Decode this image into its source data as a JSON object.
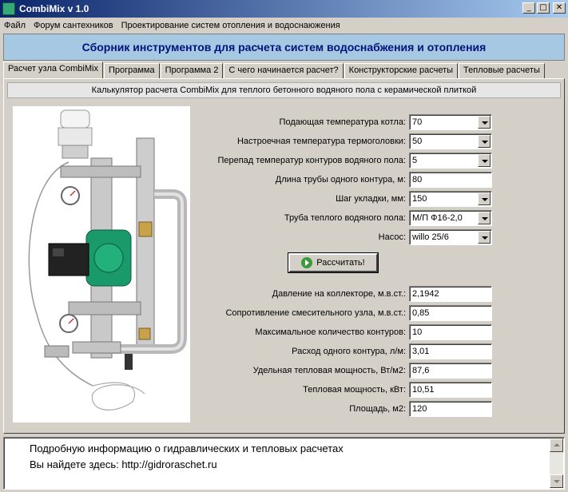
{
  "window": {
    "title": "CombiMix v 1.0",
    "btn_min": "_",
    "btn_max": "□",
    "btn_close": "✕"
  },
  "menu": [
    "Файл",
    "Форум сантехников",
    "Проектирование систем отопления и водоснаюжения"
  ],
  "banner": "Сборник инструментов для расчета систем водоснабжения и отопления",
  "tabs": [
    "Расчет узла CombiMix",
    "Программа",
    "Программа 2",
    "С чего начинается расчет?",
    "Конструкторские расчеты",
    "Тепловые расчеты"
  ],
  "calc_title": "Калькулятор расчета CombiMix для теплого бетонного водяного пола с керамической плиткой",
  "inputs": [
    {
      "label": "Подающая температура котла:",
      "value": "70",
      "combo": true
    },
    {
      "label": "Настроечная температура термоголовки:",
      "value": "50",
      "combo": true
    },
    {
      "label": "Перепад температур контуров водяного пола:",
      "value": "5",
      "combo": true
    },
    {
      "label": "Длина трубы одного контура, м:",
      "value": "80",
      "combo": false
    },
    {
      "label": "Шаг укладки, мм:",
      "value": "150",
      "combo": true
    },
    {
      "label": "Труба теплого водяного пола:",
      "value": "М/П  Ф16-2,0",
      "combo": true
    },
    {
      "label": "Насос:",
      "value": "willo 25/6",
      "combo": true
    }
  ],
  "calc_button": "Рассчитать!",
  "results": [
    {
      "label": "Давление на коллекторе, м.в.ст.:",
      "value": "2,1942"
    },
    {
      "label": "Сопротивление смесительного узла, м.в.ст.:",
      "value": "0,85"
    },
    {
      "label": "Максимальное количество контуров:",
      "value": "10"
    },
    {
      "label": "Расход одного контура, л/м:",
      "value": "3,01"
    },
    {
      "label": "Удельная тепловая мощность, Вт/м2:",
      "value": "87,6"
    },
    {
      "label": "Тепловая мощность, кВт:",
      "value": "10,51"
    },
    {
      "label": "Площадь, м2:",
      "value": "120"
    }
  ],
  "info_lines": [
    "Подробную информацию о гидравлических и тепловых расчетах",
    "Вы найдете здесь: http://gidroraschet.ru"
  ],
  "colors": {
    "title_start": "#0a246a",
    "title_end": "#a6caf0",
    "banner_bg": "#a7c8e3",
    "banner_text": "#00147a",
    "pump_green": "#1a9a6a"
  }
}
